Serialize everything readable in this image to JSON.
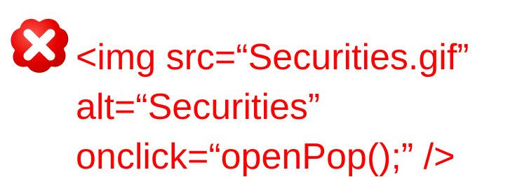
{
  "colors": {
    "text": "#ff0000",
    "icon_fill": "#e30000",
    "icon_rim": "#ffffff",
    "background": "#ffffff"
  },
  "icon": {
    "name": "error-x-icon"
  },
  "code": {
    "line1": "<img src=“Securities.gif”",
    "line2": "alt=“Securities”",
    "line3": "onclick=“openPop();” />"
  }
}
